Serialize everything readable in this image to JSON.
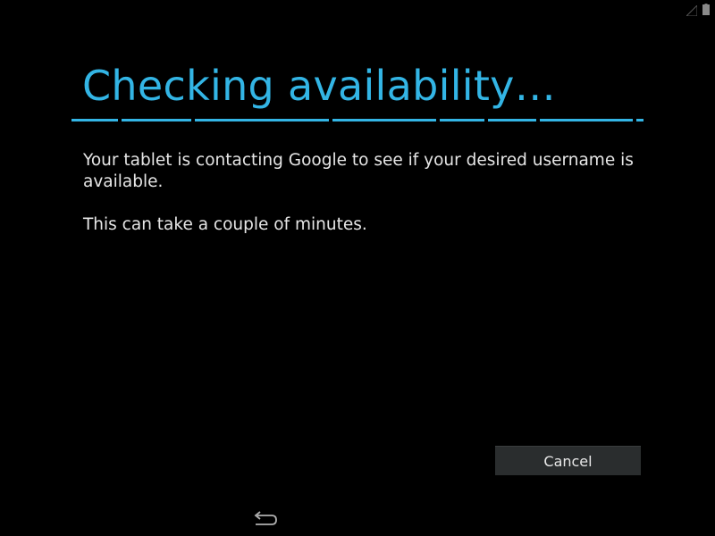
{
  "status_bar": {
    "signal_icon": "signal-icon",
    "battery_icon": "battery-icon"
  },
  "dialog": {
    "title": "Checking availability…",
    "message": "Your tablet is contacting Google to see if your desired username is available.",
    "message_secondary": "This can take a couple of minutes.",
    "cancel_label": "Cancel"
  },
  "nav_bar": {
    "back_icon": "back-icon"
  },
  "colors": {
    "accent": "#33b5e5",
    "background": "#000000",
    "text": "#e6e6e6",
    "button_bg": "#2a2d2e"
  }
}
